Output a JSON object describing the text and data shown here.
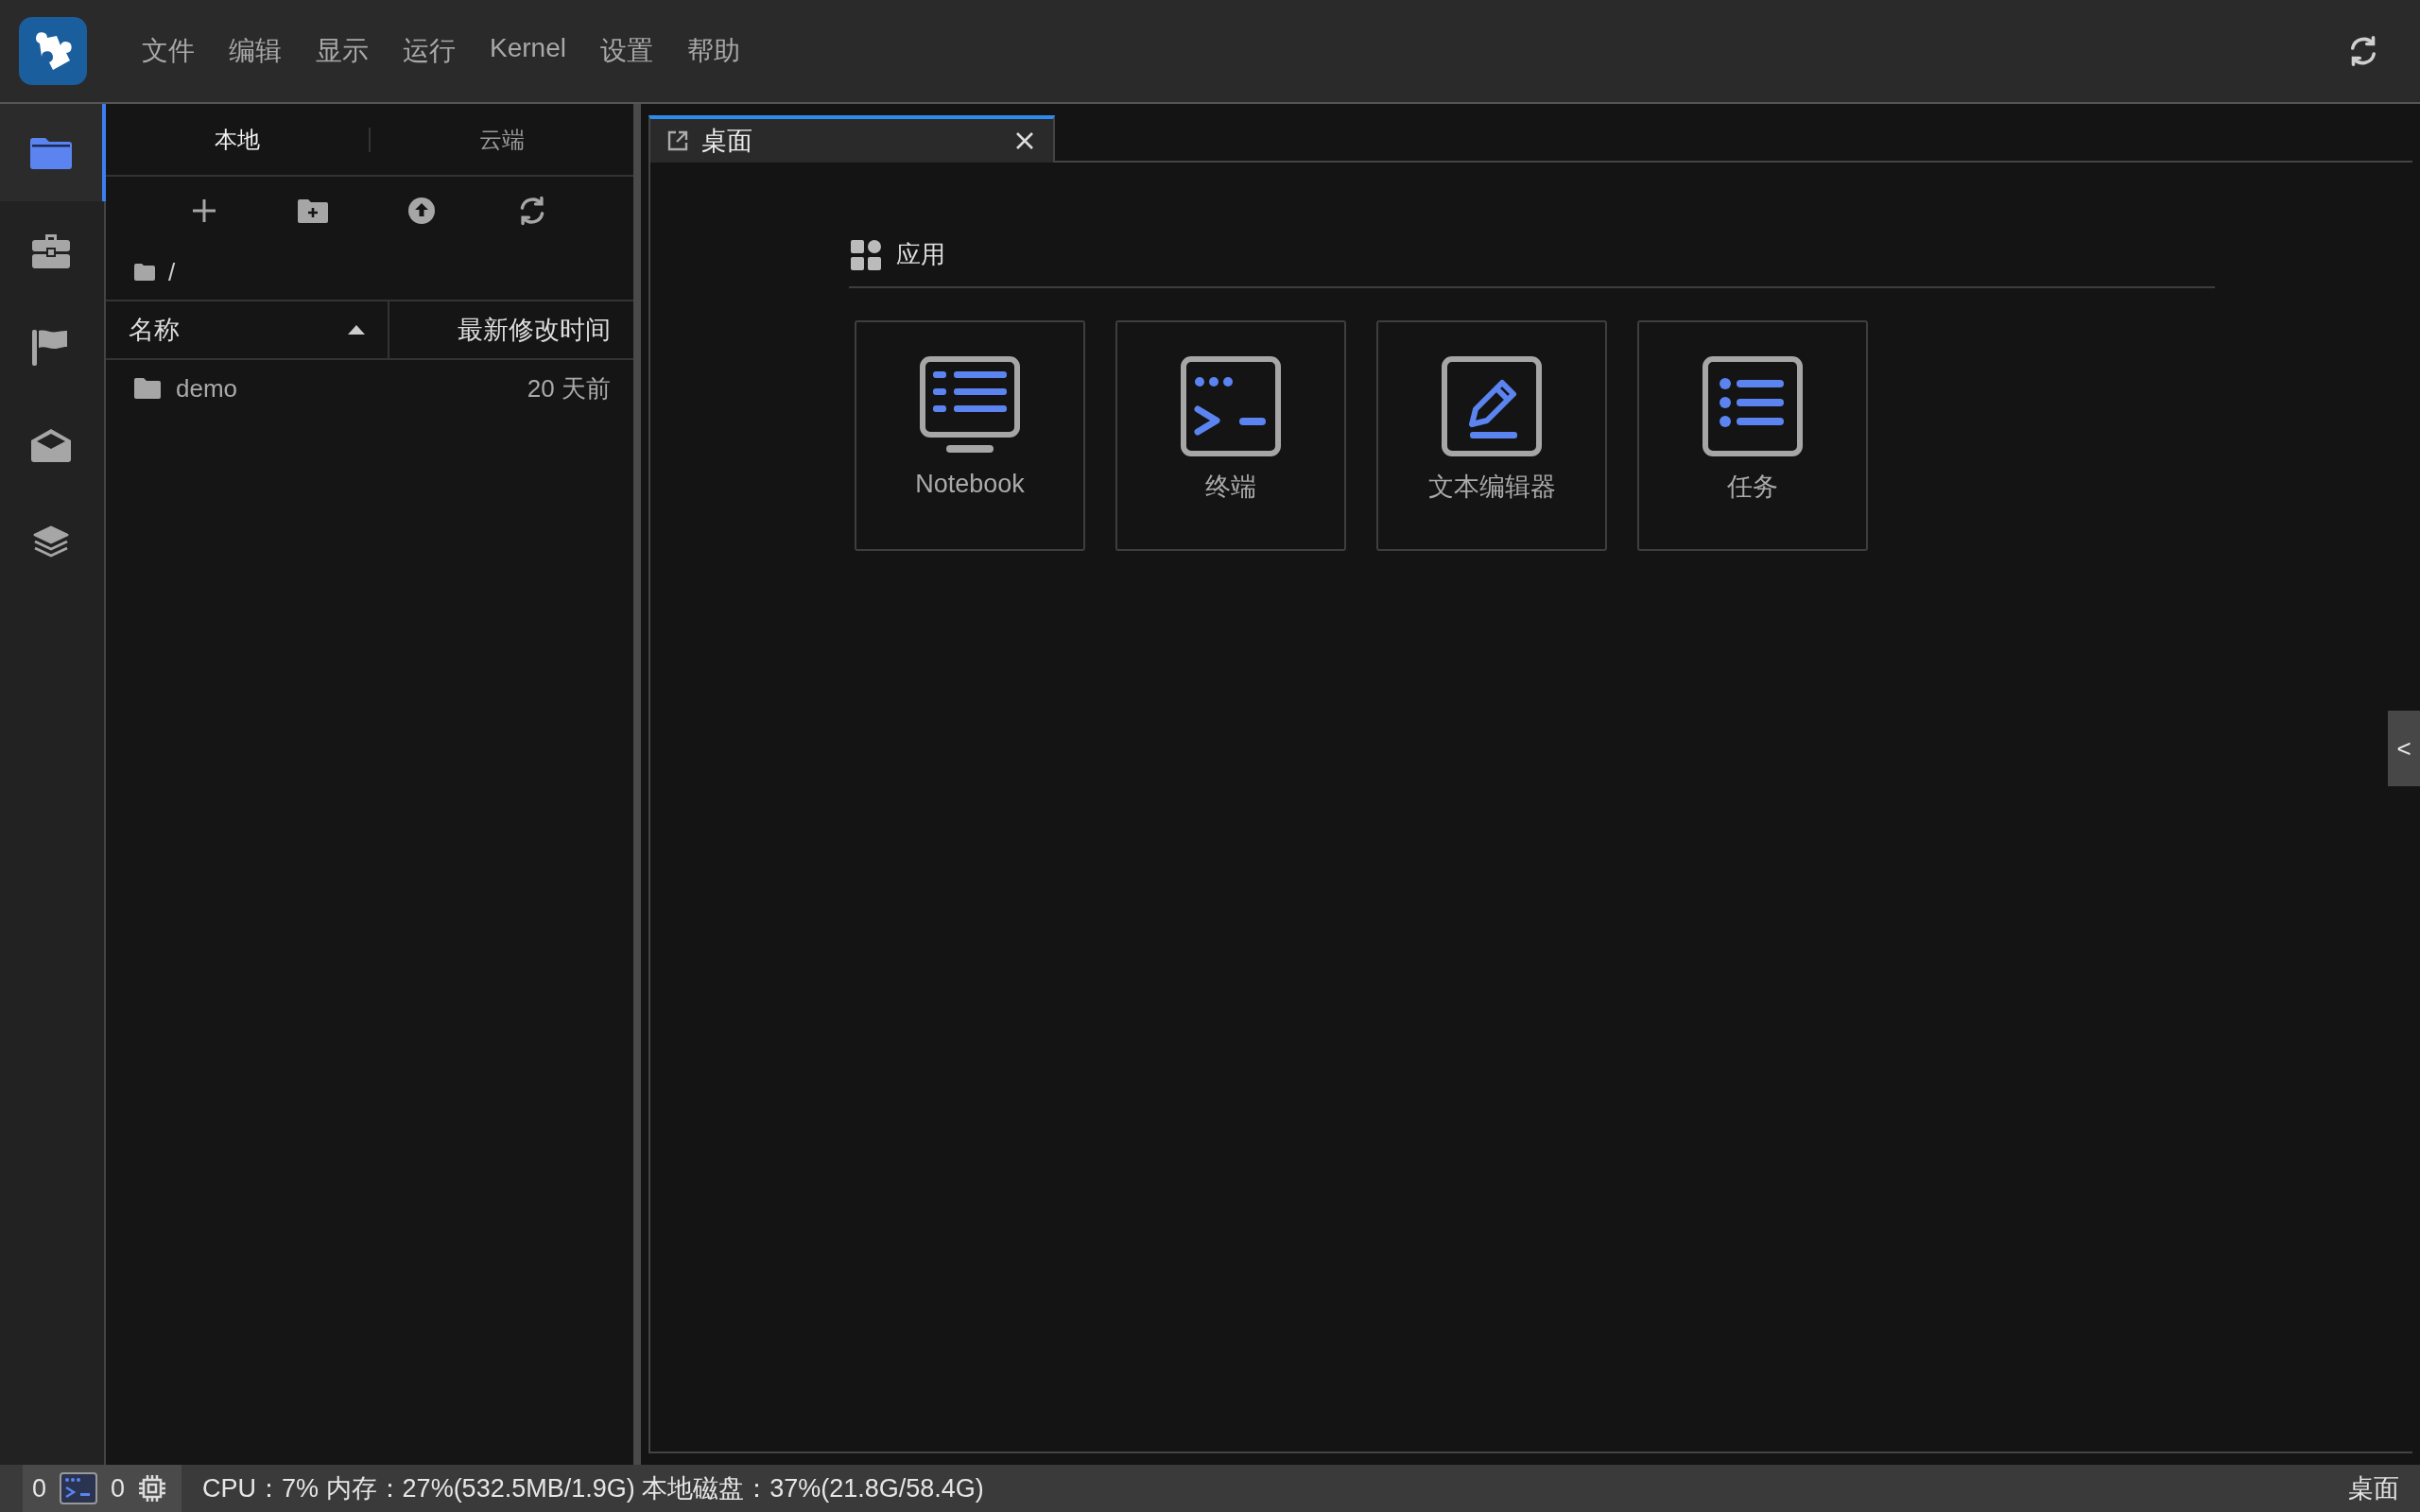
{
  "menu_bar": {
    "items": [
      "文件",
      "编辑",
      "显示",
      "运行",
      "Kernel",
      "设置",
      "帮助"
    ]
  },
  "activity_bar": {
    "items": [
      {
        "kind": "folder",
        "selected": true
      },
      {
        "kind": "briefcase",
        "selected": false
      },
      {
        "kind": "flag",
        "selected": false
      },
      {
        "kind": "envelope",
        "selected": false
      },
      {
        "kind": "layers",
        "selected": false
      }
    ]
  },
  "file_browser": {
    "tabs": [
      {
        "label": "本地",
        "selected": true
      },
      {
        "label": "云端",
        "selected": false
      }
    ],
    "toolbar": [
      {
        "kind": "new-file"
      },
      {
        "kind": "new-folder"
      },
      {
        "kind": "upload"
      },
      {
        "kind": "refresh"
      }
    ],
    "path": "/",
    "columns": [
      {
        "label": "名称",
        "sorted": true
      },
      {
        "label": "最新修改时间",
        "sorted": false
      }
    ],
    "rows": [
      {
        "kind": "folder",
        "name": "demo",
        "modified": "20 天前"
      }
    ]
  },
  "main_tabs": [
    {
      "label": "桌面",
      "selected": true
    }
  ],
  "launcher": {
    "section": "应用",
    "cards": [
      {
        "kind": "notebook",
        "label": "Notebook"
      },
      {
        "kind": "terminal",
        "label": "终端"
      },
      {
        "kind": "editor",
        "label": "文本编辑器"
      },
      {
        "kind": "tasks",
        "label": "任务"
      }
    ]
  },
  "collapse_button": "<",
  "status_bar": {
    "kernels": "0",
    "terminals": "0",
    "resources": "CPU：7% 内存：27%(532.5MB/1.9G) 本地磁盘：37%(21.8G/58.4G)",
    "current": "桌面"
  }
}
